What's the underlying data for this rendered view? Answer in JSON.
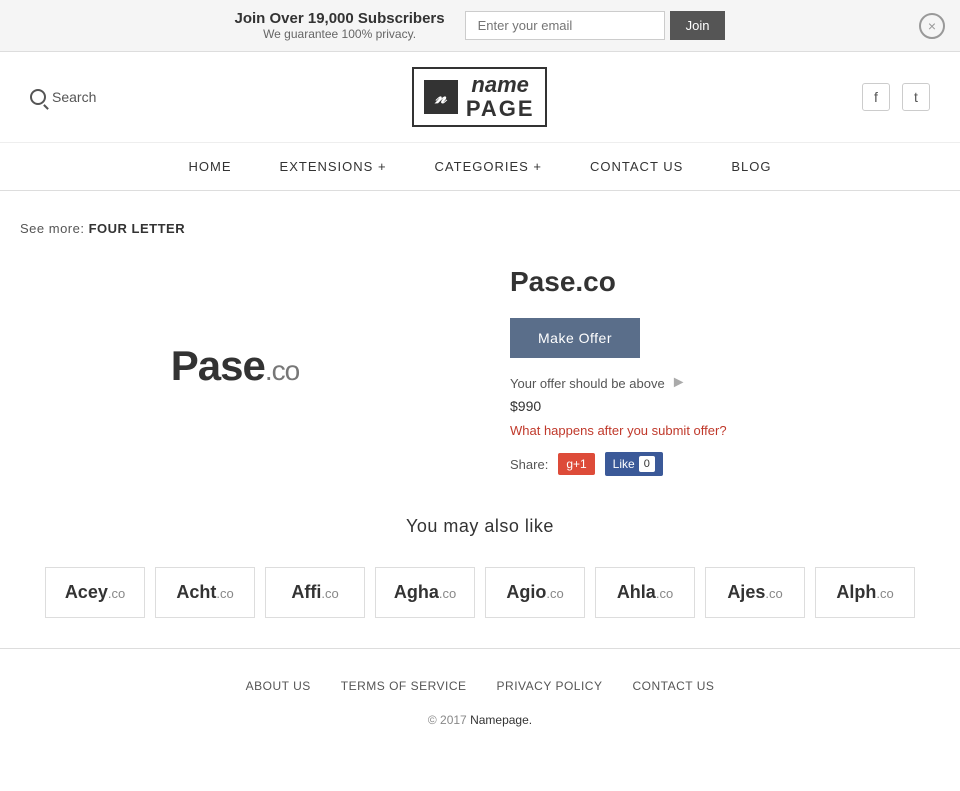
{
  "banner": {
    "main_text": "Join Over 19,000 Subscribers",
    "sub_text": "We guarantee 100% privacy.",
    "email_placeholder": "Enter your email",
    "join_btn": "Join",
    "close_label": "×"
  },
  "header": {
    "search_label": "Search",
    "logo_icon": "n",
    "logo_name": "name",
    "logo_page": "PAGE",
    "facebook_icon": "f",
    "twitter_icon": "t"
  },
  "nav": {
    "items": [
      {
        "label": "HOME",
        "id": "home"
      },
      {
        "label": "EXTENSIONS +",
        "id": "extensions"
      },
      {
        "label": "CATEGORIES +",
        "id": "categories"
      },
      {
        "label": "CONTACT US",
        "id": "contact"
      },
      {
        "label": "BLOG",
        "id": "blog"
      }
    ]
  },
  "breadcrumb": {
    "see_more_label": "See more:",
    "link_text": "FOUR LETTER"
  },
  "product": {
    "domain_name": "Pase",
    "tld": ".co",
    "full_name": "Pase.co",
    "make_offer_btn": "Make Offer",
    "offer_info": "Your offer should be above",
    "offer_price": "$990",
    "offer_link": "What happens after you submit offer?",
    "share_label": "Share:",
    "gplus_label": "g+1",
    "fb_like_label": "Like",
    "fb_count": "0"
  },
  "also_like": {
    "title": "You may also like",
    "domains": [
      {
        "name": "Acey",
        "tld": ".co"
      },
      {
        "name": "Acht",
        "tld": ".co"
      },
      {
        "name": "Affi",
        "tld": ".co"
      },
      {
        "name": "Agha",
        "tld": ".co"
      },
      {
        "name": "Agio",
        "tld": ".co"
      },
      {
        "name": "Ahla",
        "tld": ".co"
      },
      {
        "name": "Ajes",
        "tld": ".co"
      },
      {
        "name": "Alph",
        "tld": ".co"
      }
    ]
  },
  "footer": {
    "links": [
      {
        "label": "ABOUT US",
        "id": "about"
      },
      {
        "label": "TERMS OF SERVICE",
        "id": "terms"
      },
      {
        "label": "PRIVACY POLICY",
        "id": "privacy"
      },
      {
        "label": "CONTACT US",
        "id": "contact"
      }
    ],
    "copy": "© 2017",
    "copy_link": "Namepage.",
    "copy_dot": ""
  }
}
